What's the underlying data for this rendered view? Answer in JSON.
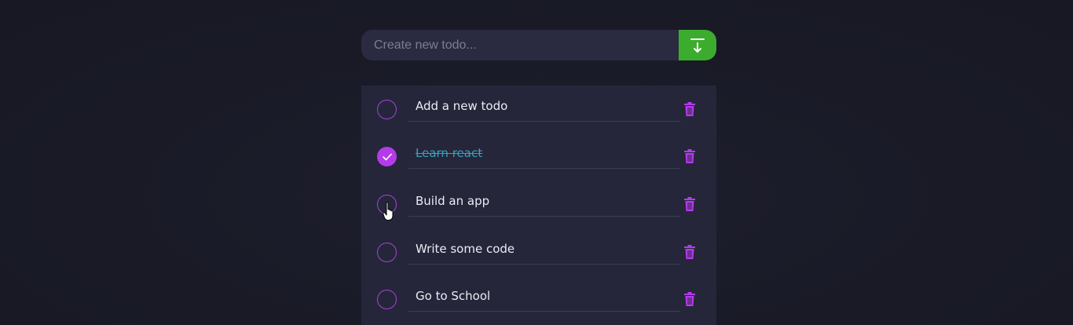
{
  "add": {
    "placeholder": "Create new todo...",
    "button_icon": "download-arrow-icon",
    "button_color": "#3cac2e"
  },
  "todos": [
    {
      "label": "Add a new todo",
      "done": false
    },
    {
      "label": "Learn react",
      "done": true
    },
    {
      "label": "Build an app",
      "done": false
    },
    {
      "label": "Write some code",
      "done": false
    },
    {
      "label": "Go to School",
      "done": false
    }
  ],
  "colors": {
    "accent": "#b43bea",
    "background": "#1b1c29",
    "list_background": "#25263a",
    "done_text": "#3a9fbf"
  },
  "icons": {
    "checkbox": "circle-icon",
    "checked": "check-icon",
    "delete": "trash-icon",
    "pointer": "hand-pointer-icon"
  }
}
